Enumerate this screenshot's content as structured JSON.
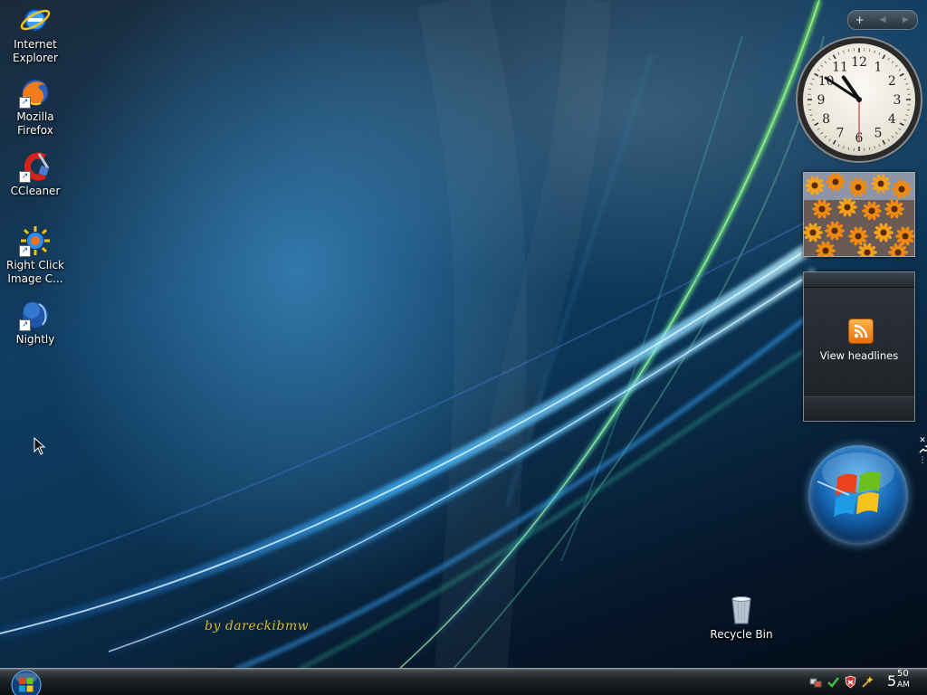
{
  "desktop": {
    "icons": [
      {
        "label_line1": "Internet",
        "label_line2": "Explorer",
        "icon": "internet-explorer-icon"
      },
      {
        "label_line1": "Mozilla",
        "label_line2": "Firefox",
        "icon": "firefox-icon"
      },
      {
        "label_line1": "CCleaner",
        "label_line2": "",
        "icon": "ccleaner-icon"
      },
      {
        "label_line1": "Right Click",
        "label_line2": "Image C...",
        "icon": "right-click-image-converter-icon"
      },
      {
        "label_line1": "Nightly",
        "label_line2": "",
        "icon": "nightly-icon"
      }
    ],
    "recycle_bin": {
      "label": "Recycle Bin",
      "icon": "recycle-bin-icon"
    },
    "signature": "by dareckibmw"
  },
  "sidebar": {
    "controls": {
      "add": "+",
      "prev": "◀",
      "next": "▶"
    },
    "clock": {
      "hour": 10,
      "minute": 50,
      "second": 30,
      "numerals": [
        "12",
        "1",
        "2",
        "3",
        "4",
        "5",
        "6",
        "7",
        "8",
        "9",
        "10",
        "11"
      ]
    },
    "slideshow": {
      "subject": "orange flowers"
    },
    "feed_headlines": {
      "label": "View headlines",
      "icon": "rss-icon"
    },
    "gadget_tools": {
      "close": "✕",
      "options": "🔧",
      "drag": "⋮"
    }
  },
  "taskbar": {
    "start_button": {
      "icon": "windows-logo-icon"
    },
    "tray_icons": [
      "network-icon",
      "safely-remove-icon",
      "security-shield-icon",
      "updates-icon"
    ],
    "clock": {
      "hour": "5",
      "minute": "50",
      "ampm": "AM"
    }
  },
  "colors": {
    "desktop_bg": "#0c3556",
    "signature": "#d6b930",
    "taskbar": "#1e2326"
  }
}
